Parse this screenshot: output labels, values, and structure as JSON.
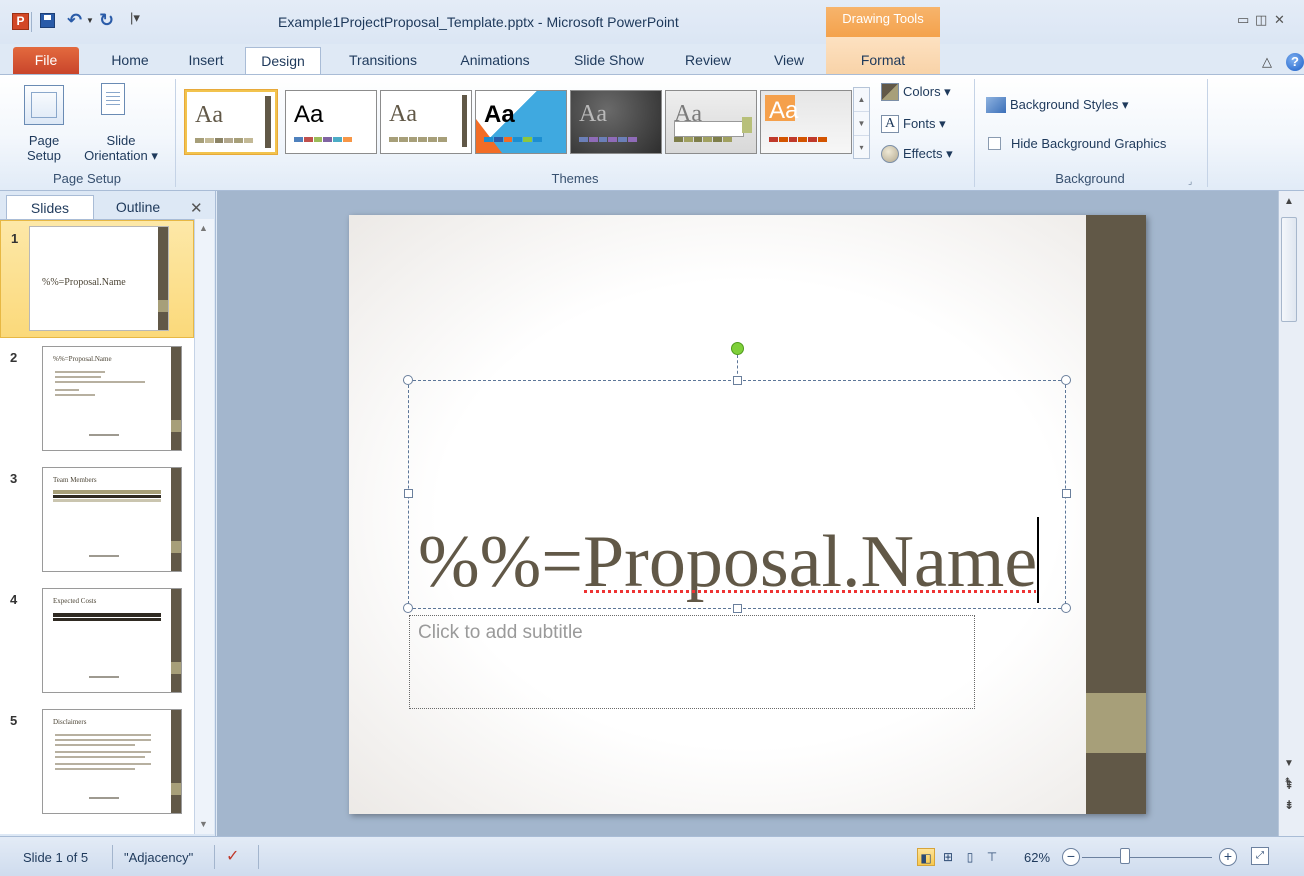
{
  "window": {
    "title": "Example1ProjectProposal_Template.pptx - Microsoft PowerPoint",
    "contextual_tab_group": "Drawing Tools",
    "app_icon_letter": "P"
  },
  "tabs": [
    {
      "label": "File"
    },
    {
      "label": "Home"
    },
    {
      "label": "Insert"
    },
    {
      "label": "Design"
    },
    {
      "label": "Transitions"
    },
    {
      "label": "Animations"
    },
    {
      "label": "Slide Show"
    },
    {
      "label": "Review"
    },
    {
      "label": "View"
    },
    {
      "label": "Format"
    }
  ],
  "active_tab": "Design",
  "ribbon": {
    "page_setup": {
      "group_label": "Page Setup",
      "page_setup_label_line1": "Page",
      "page_setup_label_line2": "Setup",
      "orientation_label_line1": "Slide",
      "orientation_label_line2": "Orientation ▾"
    },
    "themes": {
      "group_label": "Themes",
      "items": [
        {
          "aa": "Aa",
          "aa_color": "#615847",
          "bg": "#ffffff",
          "selected": true
        },
        {
          "aa": "Aa",
          "aa_color": "#000000",
          "bg": "#ffffff",
          "selected": false
        },
        {
          "aa": "Aa",
          "aa_color": "#615847",
          "bg": "#ffffff",
          "selected": false
        },
        {
          "aa": "Aa",
          "aa_color": "#000000",
          "bg": "#3fa9e0",
          "selected": false
        },
        {
          "aa": "Aa",
          "aa_color": "#b9b9b9",
          "bg": "#3a3a3a",
          "selected": false
        },
        {
          "aa": "Aa",
          "aa_color": "#7a7a7a",
          "bg": "#e8e8e8",
          "selected": false
        },
        {
          "aa": "Aa",
          "aa_color": "#f5a04b",
          "bg": "#eeeeee",
          "selected": false
        }
      ],
      "colors_label": "Colors ▾",
      "fonts_label": "Fonts ▾",
      "effects_label": "Effects ▾"
    },
    "background": {
      "group_label": "Background",
      "styles_label": "Background Styles ▾",
      "hide_graphics_label": "Hide Background Graphics",
      "hide_graphics_checked": false
    }
  },
  "left_pane": {
    "tabs": [
      "Slides",
      "Outline"
    ],
    "close_label": "✕",
    "slides": [
      {
        "number": "1",
        "title": "%%=Proposal.Name",
        "selected": true
      },
      {
        "number": "2",
        "title": "%%=Proposal.Name",
        "selected": false
      },
      {
        "number": "3",
        "title": "Team Members",
        "selected": false
      },
      {
        "number": "4",
        "title": "Expected Costs",
        "selected": false
      },
      {
        "number": "5",
        "title": "Disclaimers",
        "selected": false
      }
    ]
  },
  "slide": {
    "title_text": "%%=Proposal.Name",
    "subtitle_placeholder": "Click to add subtitle"
  },
  "status_bar": {
    "slide_position": "Slide 1 of 5",
    "theme_name": "\"Adjacency\"",
    "zoom_percent": "62%",
    "zoom_level": 0.62
  },
  "colors": {
    "theme_dark": "#615847",
    "theme_accent": "#a79f79",
    "file_tab": "#d24726",
    "contextual_tab": "#f4a24c",
    "selection_handle_rotate": "#7fd03a"
  },
  "icons": [
    "app-icon",
    "save-icon",
    "undo-icon",
    "redo-icon",
    "help-icon",
    "colors-icon",
    "fonts-icon",
    "effects-icon",
    "background-styles-icon",
    "spelling-icon",
    "normal-view-icon",
    "slide-sorter-icon",
    "reading-view-icon",
    "slideshow-icon",
    "zoom-out-icon",
    "zoom-in-icon",
    "fit-to-window-icon"
  ]
}
